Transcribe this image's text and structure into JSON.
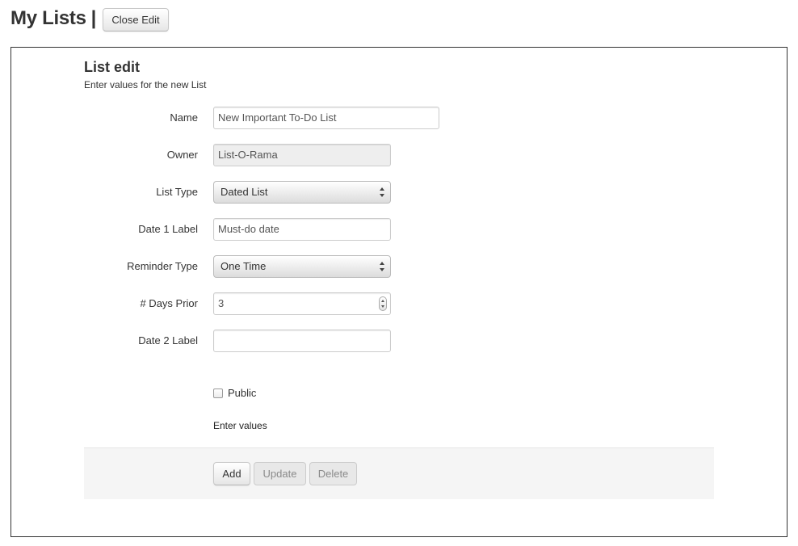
{
  "header": {
    "title": "My Lists",
    "separator": "|",
    "close_button": "Close Edit"
  },
  "form": {
    "title": "List edit",
    "subtitle": "Enter values for the new List",
    "fields": {
      "name": {
        "label": "Name",
        "value": "New Important To-Do List"
      },
      "owner": {
        "label": "Owner",
        "value": "List-O-Rama"
      },
      "list_type": {
        "label": "List Type",
        "value": "Dated List"
      },
      "date1_label": {
        "label": "Date 1 Label",
        "value": "Must-do date"
      },
      "reminder_type": {
        "label": "Reminder Type",
        "value": "One Time"
      },
      "days_prior": {
        "label": "# Days Prior",
        "value": "3"
      },
      "date2_label": {
        "label": "Date 2 Label",
        "value": ""
      }
    },
    "public": {
      "label": "Public",
      "checked": false
    },
    "hint": "Enter values",
    "actions": {
      "add": "Add",
      "update": "Update",
      "delete": "Delete"
    }
  }
}
